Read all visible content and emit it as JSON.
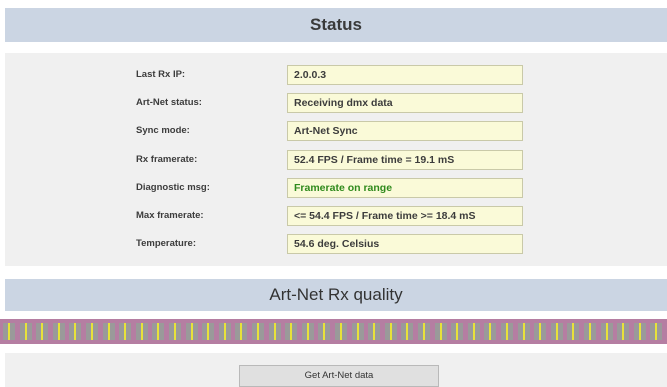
{
  "status": {
    "title": "Status",
    "rows": [
      {
        "label": "Last Rx IP:",
        "value": "2.0.0.3"
      },
      {
        "label": "Art-Net status:",
        "value": "Receiving dmx data"
      },
      {
        "label": "Sync mode:",
        "value": "Art-Net Sync"
      },
      {
        "label": "Rx framerate:",
        "value": "52.4 FPS / Frame time = 19.1 mS"
      },
      {
        "label": "Diagnostic msg:",
        "value": "Framerate on range"
      },
      {
        "label": "Max framerate:",
        "value": "<= 54.4 FPS / Frame time >= 18.4 mS"
      },
      {
        "label": "Temperature:",
        "value": "54.6 deg. Celsius"
      }
    ]
  },
  "quality": {
    "title": "Art-Net Rx quality",
    "bar_color": "#b57ea2",
    "cell_color": "#9a9a9a",
    "tick_color": "#e8e23a"
  },
  "actions": {
    "get_data_label": "Get Art-Net data"
  },
  "colors": {
    "header_bg": "#cbd5e3",
    "panel_bg": "#f0f0f0",
    "field_bg": "#fafad8",
    "ok_text": "#2f8a1c"
  }
}
